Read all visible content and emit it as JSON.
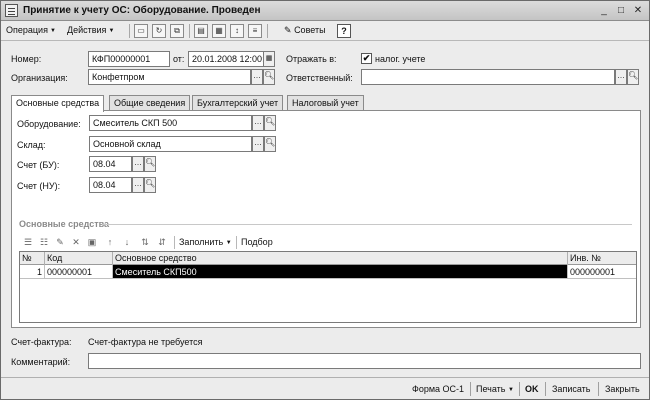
{
  "window": {
    "title": "Принятие к учету ОС: Оборудование. Проведен",
    "controls": {
      "minimize": "_",
      "maximize": "□",
      "close": "✕"
    }
  },
  "toolbar": {
    "operation_label": "Операция",
    "actions_label": "Действия",
    "icons": [
      "save-icon",
      "refresh-icon",
      "copy-icon",
      "post-icon",
      "structure-icon",
      "sort-icon",
      "list-icon"
    ],
    "advice_label": "Советы",
    "help_label": "?"
  },
  "header": {
    "number_label": "Номер:",
    "number_value": "КФП00000001",
    "from_label": "от:",
    "date_value": "20.01.2008 12:00:02",
    "reflect_label": "Отражать в:",
    "tax_check": "✔",
    "tax_label": "налог. учете",
    "org_label": "Организация:",
    "org_value": "Конфетпром",
    "responsible_label": "Ответственный:",
    "responsible_value": ""
  },
  "tabs": [
    {
      "label": "Основные средства",
      "active": true
    },
    {
      "label": "Общие сведения",
      "active": false
    },
    {
      "label": "Бухгалтерский учет",
      "active": false
    },
    {
      "label": "Налоговый учет",
      "active": false
    }
  ],
  "form": {
    "equipment_label": "Оборудование:",
    "equipment_value": "Смеситель СКП 500",
    "warehouse_label": "Склад:",
    "warehouse_value": "Основной склад",
    "account_bu_label": "Счет (БУ):",
    "account_bu_value": "08.04",
    "account_nu_label": "Счет (НУ):",
    "account_nu_value": "08.04"
  },
  "assets_section": {
    "title": "Основные средства",
    "fill_label": "Заполнить",
    "select_label": "Подбор",
    "columns": [
      "№",
      "Код",
      "Основное средство",
      "Инв. №"
    ],
    "rows": [
      {
        "num": "1",
        "code": "000000001",
        "asset": "Смеситель СКП500",
        "inv": "000000001"
      }
    ]
  },
  "invoice": {
    "label": "Счет-фактура:",
    "value": "Счет-фактура не требуется"
  },
  "comment": {
    "label": "Комментарий:",
    "value": ""
  },
  "bottom": {
    "form_os1": "Форма ОС-1",
    "print": "Печать",
    "ok": "OK",
    "save": "Записать",
    "close": "Закрыть"
  }
}
